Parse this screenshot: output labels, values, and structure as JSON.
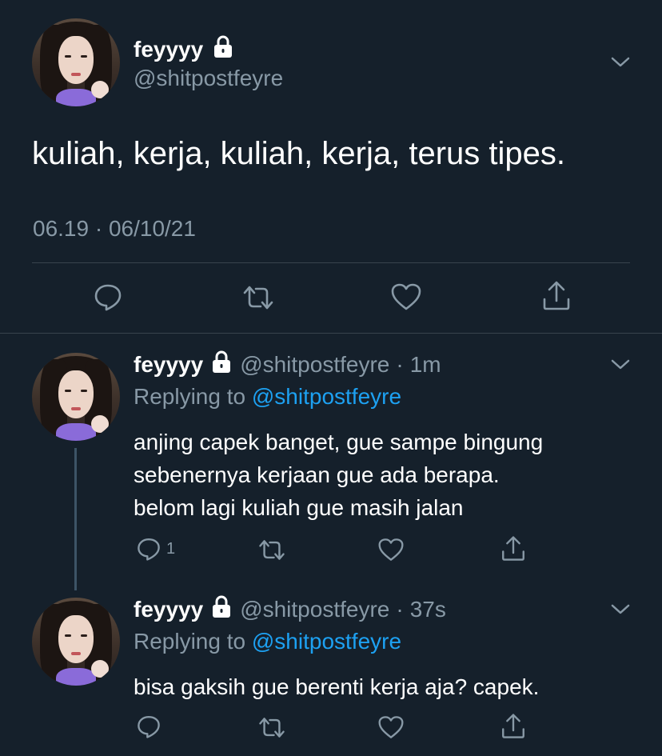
{
  "main_tweet": {
    "display_name": "feyyyy",
    "handle": "@shitpostfeyre",
    "text": "kuliah, kerja, kuliah, kerja, terus tipes.",
    "timestamp": "06.19 · 06/10/21"
  },
  "replies": [
    {
      "display_name": "feyyyy",
      "handle": "@shitpostfeyre",
      "separator": "·",
      "time": "1m",
      "replying_label": "Replying to",
      "replying_to": "@shitpostfeyre",
      "text_lines": [
        "anjing capek banget, gue sampe bingung",
        "sebenernya kerjaan gue ada berapa.",
        "belom lagi kuliah gue masih jalan"
      ],
      "reply_count": "1"
    },
    {
      "display_name": "feyyyy",
      "handle": "@shitpostfeyre",
      "separator": "·",
      "time": "37s",
      "replying_label": "Replying to",
      "replying_to": "@shitpostfeyre",
      "text_lines": [
        "bisa gaksih gue berenti kerja aja? capek."
      ],
      "reply_count": ""
    }
  ],
  "icons": {
    "reply": "reply-icon",
    "retweet": "retweet-icon",
    "like": "heart-icon",
    "share": "share-icon",
    "lock": "lock-icon",
    "more": "chevron-down-icon"
  },
  "colors": {
    "background": "#15202b",
    "muted": "#8899a6",
    "link": "#1da1f2",
    "divider": "#38444d"
  }
}
